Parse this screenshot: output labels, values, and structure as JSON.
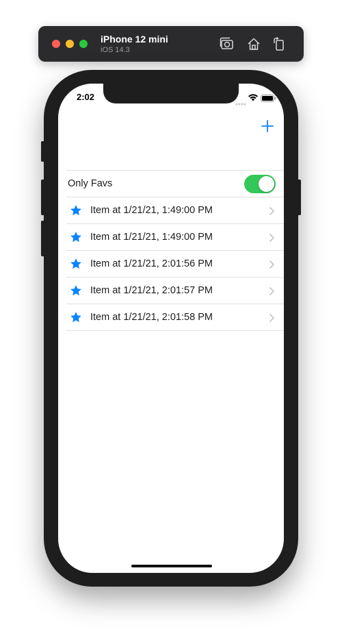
{
  "simulator": {
    "device_name": "iPhone 12 mini",
    "os_version": "iOS 14.3"
  },
  "status_bar": {
    "time": "2:02"
  },
  "nav": {
    "add_icon": "plus-icon"
  },
  "filter": {
    "label": "Only Favs",
    "toggle_on": true
  },
  "items": [
    {
      "label": "Item at 1/21/21, 1:49:00 PM",
      "favorite": true
    },
    {
      "label": "Item at 1/21/21, 1:49:00 PM",
      "favorite": true
    },
    {
      "label": "Item at 1/21/21, 2:01:56 PM",
      "favorite": true
    },
    {
      "label": "Item at 1/21/21, 2:01:57 PM",
      "favorite": true
    },
    {
      "label": "Item at 1/21/21, 2:01:58 PM",
      "favorite": true
    }
  ],
  "colors": {
    "accent": "#0a84ff",
    "toggle_on": "#34c759"
  }
}
